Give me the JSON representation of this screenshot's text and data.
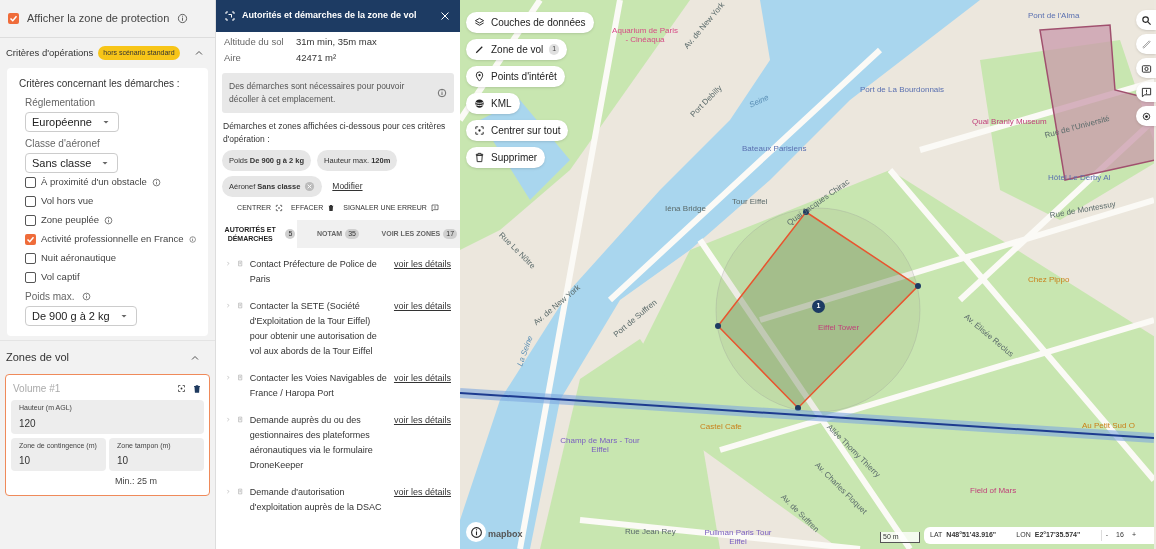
{
  "protection_zone": {
    "label": "Afficher la zone de protection",
    "checked": true
  },
  "criteria": {
    "title": "Critères d'opérations",
    "badge": "hors scénario standard",
    "expanded": true,
    "heading": "Critères concernant les démarches :",
    "regulation": {
      "label": "Réglementation",
      "value": "Européenne"
    },
    "aircraft_class": {
      "label": "Classe d'aéronef",
      "value": "Sans classe"
    },
    "options": [
      {
        "label": "À proximité d'un obstacle",
        "checked": false,
        "info": true
      },
      {
        "label": "Vol hors vue",
        "checked": false,
        "info": false
      },
      {
        "label": "Zone peuplée",
        "checked": false,
        "info": true
      },
      {
        "label": "Activité professionnelle en France",
        "checked": true,
        "info": true
      },
      {
        "label": "Nuit aéronautique",
        "checked": false,
        "info": false
      },
      {
        "label": "Vol captif",
        "checked": false,
        "info": false
      }
    ],
    "max_weight": {
      "label": "Poids max.",
      "value": "De 900 g à 2 kg"
    }
  },
  "flight_zones": {
    "title": "Zones de vol",
    "expanded": true,
    "volume": {
      "title": "Volume #1",
      "fields": [
        {
          "label": "Hauteur (m AGL)",
          "value": "120"
        },
        {
          "label": "Zone de contingence (m)",
          "value": "10"
        },
        {
          "label": "Zone tampon (m)",
          "value": "10"
        }
      ],
      "minimum": "Min.: 25 m"
    }
  },
  "panel": {
    "title": "Autorités et démarches de la zone de vol",
    "facts": [
      {
        "label": "Altitude du sol",
        "value": "31m min, 35m max"
      },
      {
        "label": "Aire",
        "value": "42471 m²"
      }
    ],
    "notice": "Des démarches sont nécessaires pour pouvoir décoller à cet emplacement.",
    "criteria_intro": "Démarches et zones affichées ci-dessous pour ces critères d'opération :",
    "chips": [
      {
        "text": "Poids **De 900 g à 2 kg**",
        "removable": false
      },
      {
        "text": "Hauteur max. **120m**",
        "removable": false
      },
      {
        "text": "Aéronef **Sans classe**",
        "removable": true
      }
    ],
    "modify_link": "Modifier",
    "actions": [
      {
        "label": "CENTRER",
        "kind": "center"
      },
      {
        "label": "EFFACER",
        "kind": "delete"
      },
      {
        "label": "SIGNALER UNE ERREUR",
        "kind": "report"
      }
    ],
    "tabs": [
      {
        "label": "AUTORITÉS ET DÉMARCHES",
        "count": "5",
        "selected": true
      },
      {
        "label": "NOTAM",
        "count": "35",
        "selected": false
      },
      {
        "label": "VOIR LES ZONES",
        "count": "17",
        "selected": false
      }
    ],
    "procedures": [
      {
        "text": "Contact Préfecture de Police de Paris",
        "link": "voir les détails"
      },
      {
        "text": "Contacter la SETE (Société d'Exploitation de la Tour Eiffel) pour obtenir une autorisation de vol aux abords de la Tour Eiffel",
        "link": "voir les détails"
      },
      {
        "text": "Contacter les Voies Navigables de France / Haropa Port",
        "link": "voir les détails"
      },
      {
        "text": "Demande auprès du ou des gestionnaires des plateformes aéronautiques via le formulaire DroneKeeper",
        "link": "voir les détails"
      },
      {
        "text": "Demande d'autorisation d'exploitation auprès de la DSAC",
        "link": "voir les détails"
      }
    ]
  },
  "map": {
    "buttons": [
      {
        "label": "Couches de données",
        "kind": "layers"
      },
      {
        "label": "Zone de vol",
        "kind": "draw",
        "count": "1"
      },
      {
        "label": "Points d'intérêt",
        "kind": "poi"
      },
      {
        "label": "KML",
        "kind": "kml"
      },
      {
        "label": "Centrer sur tout",
        "kind": "center"
      },
      {
        "label": "Supprimer",
        "kind": "delete"
      }
    ],
    "labels": [
      "Pont de l'Alma",
      "Aquarium de Paris - Cinéaqua",
      "Av. de New York",
      "Av. de New York",
      "Port Debilly",
      "Seine",
      "Port de La Bourdonnais",
      "Quai Branly Museum",
      "Rue de l'Université",
      "Hôtel Le Derby Al",
      "Bateaux Parisiens",
      "Tour Eiffel",
      "Quai Jacques Chirac",
      "Iéna Bridge",
      "Rue de Montessuy",
      "Rue Le Nôtre",
      "Chez Pippo",
      "Av. Élisée Reclus",
      "Port de Suffren",
      "Eiffel Tower",
      "La Seine",
      "Castel Cafe",
      "Champ de Mars - Tour Eiffel",
      "Allée Thomy Thierry",
      "Av. Charles Floquet",
      "Au Petit Sud O",
      "Field of Mars",
      "Av. de Suffren",
      "Rue Jean Rey",
      "Pullman Paris Tour Eiffel"
    ],
    "marker": "1",
    "logo": "mapbox",
    "scale": "50 m",
    "lat_label": "LAT",
    "lat": "N48°51'43.916\"",
    "lon_label": "LON",
    "lon": "E2°17'35.574\"",
    "zoom_out": "-",
    "zoom": "16",
    "zoom_in": "+"
  }
}
